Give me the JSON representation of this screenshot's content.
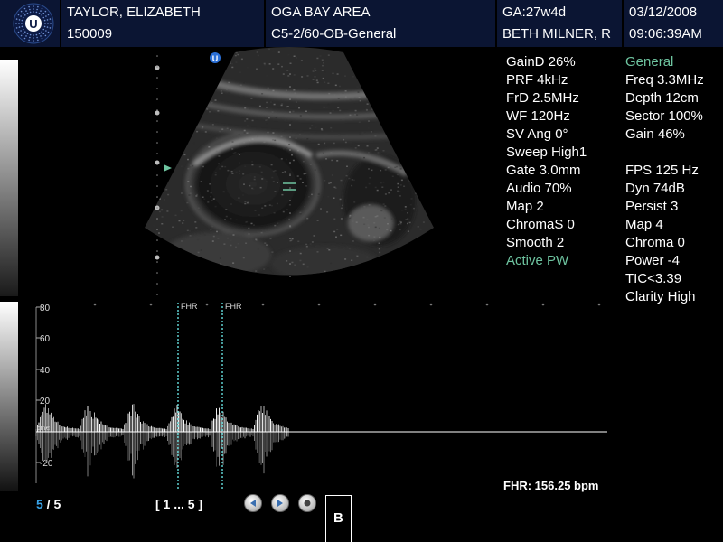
{
  "header": {
    "patient_name": "TAYLOR, ELIZABETH",
    "patient_id": "150009",
    "institution": "OGA BAY AREA",
    "probe_preset": "C5-2/60-OB-General",
    "gestational_age": "GA:27w4d",
    "operator": "BETH MILNER, R",
    "date": "03/12/2008",
    "time": "09:06:39AM",
    "logo_letter": "U"
  },
  "image_marker": "U",
  "doppler_params": [
    "GainD 26%",
    "PRF 4kHz",
    "FrD 2.5MHz",
    "WF 120Hz",
    "SV Ang 0°",
    "Sweep High1",
    "Gate 3.0mm",
    "Audio 70%",
    "Map 2",
    "ChromaS 0",
    "Smooth 2"
  ],
  "doppler_mode": "Active PW",
  "bmode_mode": "General",
  "bmode_params": [
    "Freq 3.3MHz",
    "Depth 12cm",
    "Sector 100%",
    "Gain 46%",
    "",
    "FPS 125 Hz",
    "Dyn 74dB",
    "Persist 3",
    "Map 4",
    "Chroma 0",
    "Power -4",
    "TIC<3.39",
    "Clarity High"
  ],
  "spectrum": {
    "scale_labels": [
      "80",
      "60",
      "40",
      "20",
      "-20"
    ],
    "baseline_unit": "cm/s",
    "fhr_markers": [
      "FHR",
      "FHR"
    ],
    "fhr_readout": "FHR: 156.25 bpm"
  },
  "footer": {
    "page_current": "5",
    "page_separator": " / ",
    "page_total": "5",
    "range": "[ 1 ... 5 ]",
    "mode_box": "B"
  },
  "colors": {
    "header_bg": "#0b1533",
    "accent_green": "#6ec4a0",
    "page_current": "#38a3e8",
    "fhr_line": "#5fd0d0"
  }
}
